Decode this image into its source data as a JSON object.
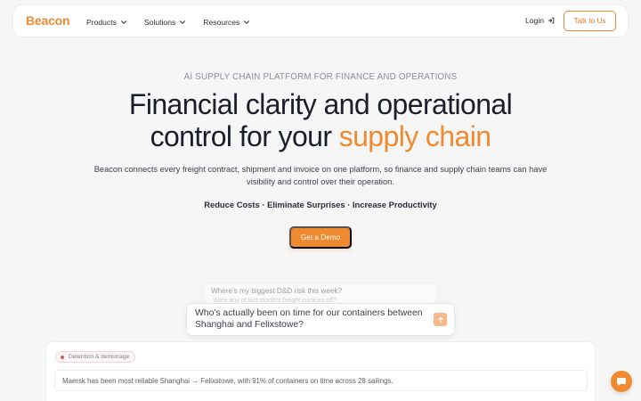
{
  "brand": {
    "logo_text": "Beacon",
    "accent_color": "#f08a30"
  },
  "nav": {
    "items": [
      {
        "label": "Products",
        "icon": "chevron-down-icon"
      },
      {
        "label": "Solutions",
        "icon": "chevron-down-icon"
      },
      {
        "label": "Resources",
        "icon": "chevron-down-icon"
      }
    ],
    "login_label": "Login",
    "login_icon": "login-icon",
    "cta_label": "Talk to Us"
  },
  "hero": {
    "eyebrow": "AI SUPPLY CHAIN PLATFORM FOR FINANCE AND OPERATIONS",
    "headline_line1": "Financial clarity and operational",
    "headline_line2_prefix": "control for your ",
    "headline_accent": "supply chain",
    "subtext": "Beacon connects every freight contract, shipment and invoice on one platform, so finance and supply chain teams can have visibility and control over their operation.",
    "tagline": "Reduce Costs · Eliminate Surprises · Increase Productivity",
    "cta_label": "Get a Demo"
  },
  "queries": {
    "back_question": "Where's my biggest D&D risk this week?",
    "back_question_2": "Were any of last month's freight invoices off?",
    "main_question": "Who's actually been on time for our containers between Shanghai and Felixstowe?",
    "send_icon": "arrow-up-icon"
  },
  "answer": {
    "badge_label": "Detention & demurrage",
    "text": "Maersk has been most reliable Shanghai → Felixstowe, with 91% of containers on time across 28 sailings."
  },
  "chat": {
    "icon": "chat-bubble-icon"
  }
}
